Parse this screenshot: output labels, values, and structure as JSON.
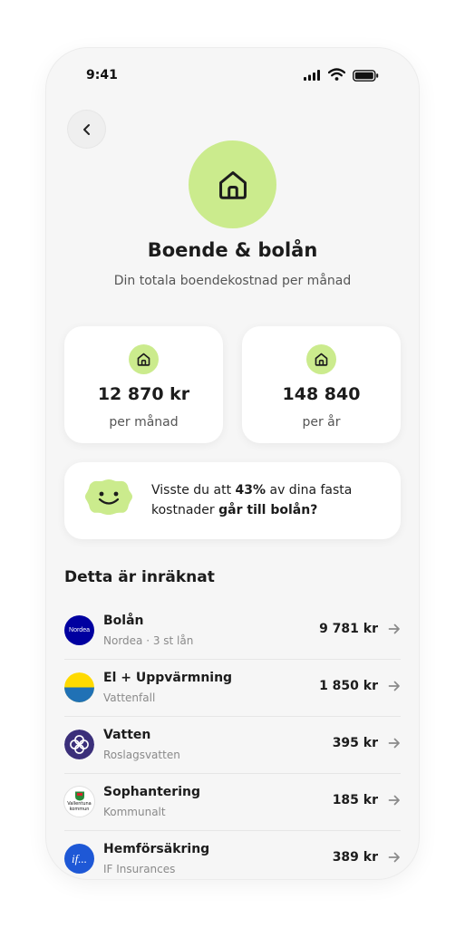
{
  "status_bar": {
    "time": "9:41"
  },
  "header": {
    "title": "Boende & bolån",
    "subtitle": "Din totala boendekostnad per månad"
  },
  "stats": [
    {
      "value": "12 870 kr",
      "label": "per månad"
    },
    {
      "value": "148 840",
      "label": "per år"
    }
  ],
  "tip": {
    "part1": "Visste du att ",
    "highlight": "43%",
    "part2": " av dina fasta kostnader ",
    "bold_end": "går till bolån?"
  },
  "section_title": "Detta är inräknat",
  "items": [
    {
      "name": "Bolån",
      "sub": "Nordea · 3 st lån",
      "amount": "9 781 kr",
      "logo_text": "Nordea",
      "icon": "nordea-logo"
    },
    {
      "name": "El + Uppvärmning",
      "sub": "Vattenfall",
      "amount": "1 850 kr",
      "icon": "vattenfall-logo"
    },
    {
      "name": "Vatten",
      "sub": "Roslagsvatten",
      "amount": "395 kr",
      "icon": "roslagsvatten-logo"
    },
    {
      "name": "Sophantering",
      "sub": "Kommunalt",
      "amount": "185 kr",
      "logo_text": "Vallentuna kommun",
      "icon": "vallentuna-logo"
    },
    {
      "name": "Hemförsäkring",
      "sub": "IF Insurances",
      "amount": "389 kr",
      "logo_text": "if...",
      "icon": "if-logo"
    }
  ],
  "colors": {
    "accent_green": "#cbeb8d",
    "nordea_blue": "#0000a0",
    "vattenfall_yellow": "#ffda00",
    "vattenfall_blue": "#2071b5",
    "if_blue": "#1e58d6"
  }
}
